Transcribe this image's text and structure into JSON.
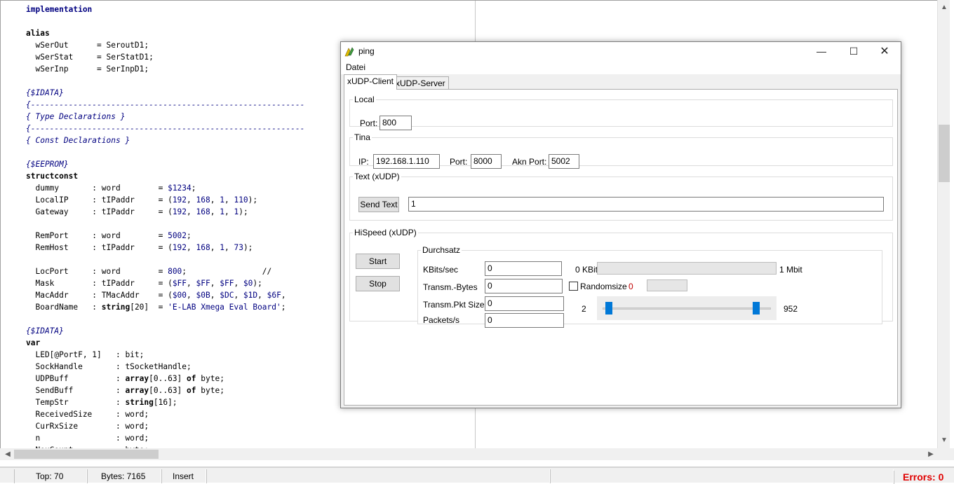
{
  "editor": {
    "lines": [
      [
        {
          "t": "implementation",
          "c": "kw"
        }
      ],
      [],
      [
        {
          "t": "alias",
          "c": "tb"
        }
      ],
      [
        {
          "t": "  wSerOut      = SeroutD1;"
        }
      ],
      [
        {
          "t": "  wSerStat     = SerStatD1;"
        }
      ],
      [
        {
          "t": "  wSerInp      = SerInpD1;"
        }
      ],
      [],
      [
        {
          "t": "{$IDATA}",
          "c": "cm"
        }
      ],
      [
        {
          "t": "{----------------------------------------------------------",
          "c": "cm"
        }
      ],
      [
        {
          "t": "{ Type Declarations }",
          "c": "cm"
        }
      ],
      [
        {
          "t": "{----------------------------------------------------------",
          "c": "cm"
        }
      ],
      [
        {
          "t": "{ Const Declarations }",
          "c": "cm"
        }
      ],
      [],
      [
        {
          "t": "{$EEPROM}",
          "c": "cm"
        }
      ],
      [
        {
          "t": "structconst",
          "c": "tb"
        }
      ],
      [
        {
          "t": "  dummy       : word        = "
        },
        {
          "t": "$1234",
          "c": "num"
        },
        {
          "t": ";"
        }
      ],
      [
        {
          "t": "  LocalIP     : tIPaddr     = ("
        },
        {
          "t": "192",
          "c": "num"
        },
        {
          "t": ", "
        },
        {
          "t": "168",
          "c": "num"
        },
        {
          "t": ", "
        },
        {
          "t": "1",
          "c": "num"
        },
        {
          "t": ", "
        },
        {
          "t": "110",
          "c": "num"
        },
        {
          "t": ");"
        }
      ],
      [
        {
          "t": "  Gateway     : tIPaddr     = ("
        },
        {
          "t": "192",
          "c": "num"
        },
        {
          "t": ", "
        },
        {
          "t": "168",
          "c": "num"
        },
        {
          "t": ", "
        },
        {
          "t": "1",
          "c": "num"
        },
        {
          "t": ", "
        },
        {
          "t": "1",
          "c": "num"
        },
        {
          "t": ");"
        }
      ],
      [],
      [
        {
          "t": "  RemPort     : word        = "
        },
        {
          "t": "5002",
          "c": "num"
        },
        {
          "t": ";"
        }
      ],
      [
        {
          "t": "  RemHost     : tIPaddr     = ("
        },
        {
          "t": "192",
          "c": "num"
        },
        {
          "t": ", "
        },
        {
          "t": "168",
          "c": "num"
        },
        {
          "t": ", "
        },
        {
          "t": "1",
          "c": "num"
        },
        {
          "t": ", "
        },
        {
          "t": "73",
          "c": "num"
        },
        {
          "t": ");"
        }
      ],
      [],
      [
        {
          "t": "  LocPort     : word        = "
        },
        {
          "t": "800",
          "c": "num"
        },
        {
          "t": ";                //"
        }
      ],
      [
        {
          "t": "  Mask        : tIPaddr     = ("
        },
        {
          "t": "$FF",
          "c": "num"
        },
        {
          "t": ", "
        },
        {
          "t": "$FF",
          "c": "num"
        },
        {
          "t": ", "
        },
        {
          "t": "$FF",
          "c": "num"
        },
        {
          "t": ", "
        },
        {
          "t": "$0",
          "c": "num"
        },
        {
          "t": ");"
        }
      ],
      [
        {
          "t": "  MacAddr     : TMacAddr    = ("
        },
        {
          "t": "$00",
          "c": "num"
        },
        {
          "t": ", "
        },
        {
          "t": "$0B",
          "c": "num"
        },
        {
          "t": ", "
        },
        {
          "t": "$DC",
          "c": "num"
        },
        {
          "t": ", "
        },
        {
          "t": "$1D",
          "c": "num"
        },
        {
          "t": ", "
        },
        {
          "t": "$6F",
          "c": "num"
        },
        {
          "t": ", "
        }
      ],
      [
        {
          "t": "  BoardName   : "
        },
        {
          "t": "string",
          "c": "tb"
        },
        {
          "t": "[20]  = "
        },
        {
          "t": "'E-LAB Xmega Eval Board'",
          "c": "str"
        },
        {
          "t": ";"
        }
      ],
      [],
      [
        {
          "t": "{$IDATA}",
          "c": "cm"
        }
      ],
      [
        {
          "t": "var",
          "c": "tb"
        }
      ],
      [
        {
          "t": "  LED[@PortF, 1]   : bit;"
        }
      ],
      [
        {
          "t": "  SockHandle       : tSocketHandle;"
        }
      ],
      [
        {
          "t": "  UDPBuff          : "
        },
        {
          "t": "array",
          "c": "tb"
        },
        {
          "t": "[0..63] "
        },
        {
          "t": "of",
          "c": "tb"
        },
        {
          "t": " byte;"
        }
      ],
      [
        {
          "t": "  SendBuff         : "
        },
        {
          "t": "array",
          "c": "tb"
        },
        {
          "t": "[0..63] "
        },
        {
          "t": "of",
          "c": "tb"
        },
        {
          "t": " byte;"
        }
      ],
      [
        {
          "t": "  TempStr          : "
        },
        {
          "t": "string",
          "c": "tb"
        },
        {
          "t": "[16];"
        }
      ],
      [
        {
          "t": "  ReceivedSize     : word;"
        }
      ],
      [
        {
          "t": "  CurRxSize        : word;"
        }
      ],
      [
        {
          "t": "  n                : word;"
        }
      ],
      [
        {
          "t": "  NeuCount         : byte;"
        }
      ]
    ]
  },
  "statusbar": {
    "top": "Top: 70",
    "bytes": "Bytes: 7165",
    "mode": "Insert",
    "errors": "Errors: 0"
  },
  "dialog": {
    "title": "ping",
    "menu": {
      "datei": "Datei"
    },
    "tabs": {
      "client": "xUDP-Client",
      "server": "xUDP-Server"
    },
    "local": {
      "legend": "Local",
      "port_label": "Port:",
      "port_value": "800"
    },
    "tina": {
      "legend": "Tina",
      "ip_label": "IP:",
      "ip_value": "192.168.1.110",
      "port_label": "Port:",
      "port_value": "8000",
      "akn_label": "Akn Port:",
      "akn_value": "5002"
    },
    "text": {
      "legend": "Text (xUDP)",
      "send_button": "Send Text",
      "text_value": "1"
    },
    "hispeed": {
      "legend": "HiSpeed (xUDP)",
      "start_button": "Start",
      "stop_button": "Stop",
      "durchsatz": {
        "legend": "Durchsatz",
        "kbits_label": "KBits/sec",
        "kbits_value": "0",
        "bytes_label": "Transm.-Bytes",
        "bytes_value": "0",
        "pkt_label": "Transm.Pkt Size",
        "pkt_value": "0",
        "pps_label": "Packets/s",
        "pps_value": "0",
        "bar_min": "0 KBit",
        "bar_max": "1 Mbit",
        "bar_progress": 0,
        "randomsize_label": "Randomsize",
        "randomsize_value": "0",
        "randomsize_checked": false,
        "slider_min": "2",
        "slider_max": "952"
      }
    }
  }
}
